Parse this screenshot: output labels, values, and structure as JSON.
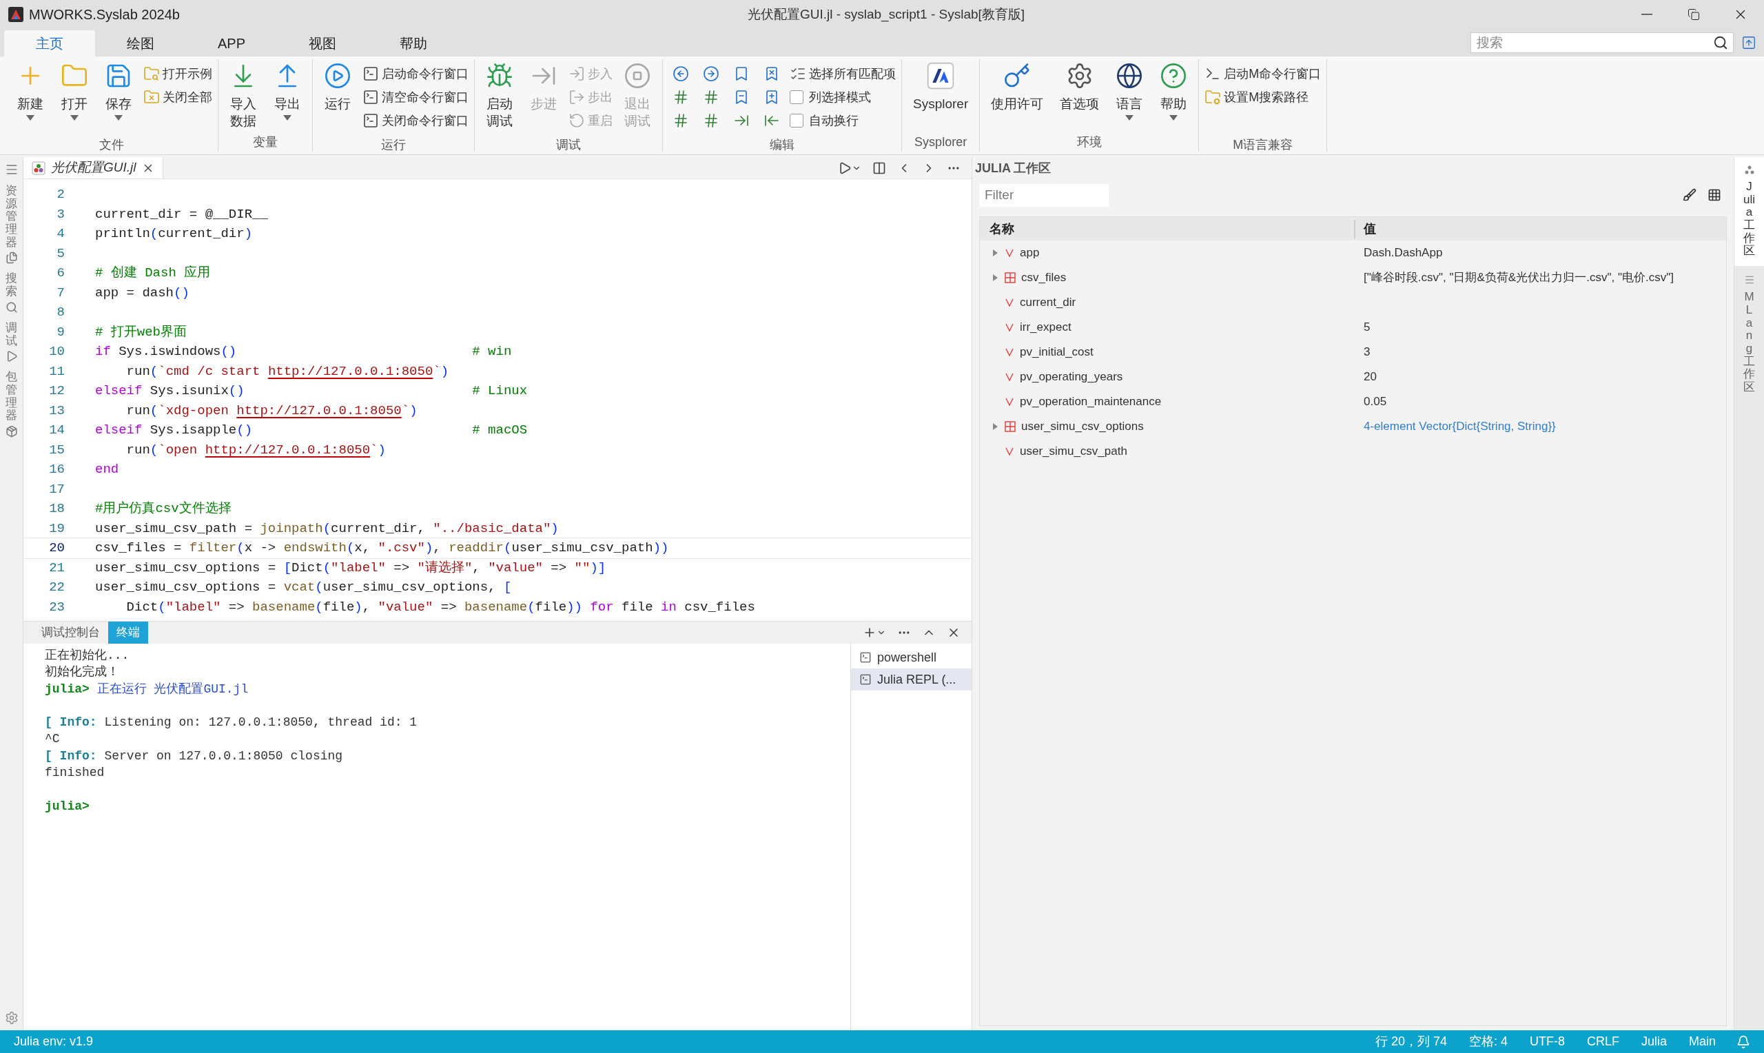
{
  "window": {
    "app_name": "MWORKS.Syslab 2024b",
    "title": "光伏配置GUI.jl - syslab_script1 - Syslab[教育版]"
  },
  "ribbon_tabs": [
    {
      "label": "主页",
      "selected": true
    },
    {
      "label": "绘图",
      "selected": false
    },
    {
      "label": "APP",
      "selected": false
    },
    {
      "label": "视图",
      "selected": false
    },
    {
      "label": "帮助",
      "selected": false
    }
  ],
  "search": {
    "placeholder": "搜索"
  },
  "ribbon_groups": [
    {
      "label": "文件",
      "items": [
        {
          "kind": "large",
          "lines": [
            "新建"
          ],
          "dropdown": true,
          "disabled": false
        },
        {
          "kind": "large",
          "lines": [
            "打开"
          ],
          "dropdown": true,
          "disabled": false
        },
        {
          "kind": "large",
          "lines": [
            "保存"
          ],
          "dropdown": true,
          "disabled": false
        },
        {
          "kind": "small",
          "label": "打开示例",
          "disabled": false
        },
        {
          "kind": "small",
          "label": "关闭全部",
          "disabled": false
        }
      ]
    },
    {
      "label": "变量",
      "items": [
        {
          "kind": "large",
          "lines": [
            "导入",
            "数据"
          ],
          "dropdown": false,
          "disabled": false
        },
        {
          "kind": "large",
          "lines": [
            "导出"
          ],
          "dropdown": true,
          "disabled": false
        }
      ]
    },
    {
      "label": "运行",
      "items": [
        {
          "kind": "large",
          "lines": [
            "运行"
          ],
          "dropdown": false,
          "disabled": false
        },
        {
          "kind": "small",
          "label": "启动命令行窗口",
          "disabled": false
        },
        {
          "kind": "small",
          "label": "清空命令行窗口",
          "disabled": false
        },
        {
          "kind": "small",
          "label": "关闭命令行窗口",
          "disabled": false
        }
      ]
    },
    {
      "label": "调试",
      "items": [
        {
          "kind": "large",
          "lines": [
            "启动",
            "调试"
          ],
          "dropdown": false,
          "disabled": false
        },
        {
          "kind": "large",
          "lines": [
            "步进"
          ],
          "dropdown": false,
          "disabled": true
        },
        {
          "kind": "small",
          "label": "步入",
          "disabled": true
        },
        {
          "kind": "small",
          "label": "步出",
          "disabled": true
        },
        {
          "kind": "small",
          "label": "重启",
          "disabled": true
        },
        {
          "kind": "large",
          "lines": [
            "退出",
            "调试"
          ],
          "dropdown": false,
          "disabled": true
        }
      ]
    },
    {
      "label": "编辑",
      "items": [
        {
          "kind": "icon",
          "disabled": false
        },
        {
          "kind": "icon",
          "disabled": false
        },
        {
          "kind": "icon",
          "disabled": false
        },
        {
          "kind": "icon",
          "disabled": false
        },
        {
          "kind": "icon",
          "disabled": false
        },
        {
          "kind": "icon",
          "disabled": false
        },
        {
          "kind": "icon",
          "disabled": false
        },
        {
          "kind": "icon",
          "disabled": false
        },
        {
          "kind": "icon",
          "disabled": false
        },
        {
          "kind": "icon",
          "disabled": false
        },
        {
          "kind": "icon",
          "disabled": false
        },
        {
          "kind": "icon",
          "disabled": false
        },
        {
          "kind": "small",
          "label": "选择所有匹配项",
          "disabled": false
        },
        {
          "kind": "check",
          "label": "列选择模式",
          "checked": false
        },
        {
          "kind": "check",
          "label": "自动换行",
          "checked": false
        }
      ]
    },
    {
      "label": "Sysplorer",
      "items": [
        {
          "kind": "large",
          "lines": [
            "Sysplorer"
          ],
          "dropdown": false,
          "disabled": false
        }
      ]
    },
    {
      "label": "环境",
      "items": [
        {
          "kind": "large",
          "lines": [
            "使用许可"
          ],
          "dropdown": false,
          "disabled": false
        },
        {
          "kind": "large",
          "lines": [
            "首选项"
          ],
          "dropdown": false,
          "disabled": false
        },
        {
          "kind": "large",
          "lines": [
            "语言"
          ],
          "dropdown": true,
          "disabled": false
        },
        {
          "kind": "large",
          "lines": [
            "帮助"
          ],
          "dropdown": true,
          "disabled": false
        }
      ]
    },
    {
      "label": "M语言兼容",
      "items": [
        {
          "kind": "small",
          "label": "启动M命令行窗口",
          "disabled": false
        },
        {
          "kind": "small",
          "label": "设置M搜索路径",
          "disabled": false
        }
      ]
    }
  ],
  "activity_bar": [
    {
      "label": "资源管理器"
    },
    {
      "label": "搜索"
    },
    {
      "label": "调试"
    },
    {
      "label": "包管理器"
    }
  ],
  "editor": {
    "tab": {
      "label": "光伏配置GUI.jl"
    },
    "lines": [
      {
        "number": "2",
        "current": false
      },
      {
        "number": "3",
        "current": false,
        "tokens": [
          {
            "kind": "plain",
            "text": "current_dir = @__DIR__"
          }
        ]
      },
      {
        "number": "4",
        "current": false,
        "tokens": [
          {
            "kind": "plain",
            "text": "println"
          },
          {
            "kind": "bracket",
            "text": "("
          },
          {
            "kind": "plain",
            "text": "current_dir"
          },
          {
            "kind": "bracket",
            "text": ")"
          }
        ]
      },
      {
        "number": "5",
        "current": false
      },
      {
        "number": "6",
        "current": false,
        "tokens": [
          {
            "kind": "comment",
            "text": "# 创建 Dash 应用"
          }
        ]
      },
      {
        "number": "7",
        "current": false,
        "tokens": [
          {
            "kind": "plain",
            "text": "app = dash"
          },
          {
            "kind": "bracket",
            "text": "()"
          }
        ]
      },
      {
        "number": "8",
        "current": false
      },
      {
        "number": "9",
        "current": false,
        "tokens": [
          {
            "kind": "comment",
            "text": "# 打开web界面"
          }
        ]
      },
      {
        "number": "10",
        "current": false,
        "tokens": [
          {
            "kind": "keyword",
            "text": "if"
          },
          {
            "kind": "plain",
            "text": " Sys.iswindows"
          },
          {
            "kind": "bracket",
            "text": "()"
          },
          {
            "kind": "aligned_comment",
            "text": "# win"
          }
        ]
      },
      {
        "number": "11",
        "current": false,
        "tokens": [
          {
            "kind": "plain",
            "text": "    run"
          },
          {
            "kind": "bracket",
            "text": "("
          },
          {
            "kind": "string",
            "text": "`cmd /c start "
          },
          {
            "kind": "url",
            "text": "http://127.0.0.1:8050"
          },
          {
            "kind": "string",
            "text": "`"
          },
          {
            "kind": "bracket",
            "text": ")"
          }
        ]
      },
      {
        "number": "12",
        "current": false,
        "tokens": [
          {
            "kind": "keyword",
            "text": "elseif"
          },
          {
            "kind": "plain",
            "text": " Sys.isunix"
          },
          {
            "kind": "bracket",
            "text": "()"
          },
          {
            "kind": "aligned_comment",
            "text": "# Linux"
          }
        ]
      },
      {
        "number": "13",
        "current": false,
        "tokens": [
          {
            "kind": "plain",
            "text": "    run"
          },
          {
            "kind": "bracket",
            "text": "("
          },
          {
            "kind": "string",
            "text": "`xdg-open "
          },
          {
            "kind": "url",
            "text": "http://127.0.0.1:8050"
          },
          {
            "kind": "string",
            "text": "`"
          },
          {
            "kind": "bracket",
            "text": ")"
          }
        ]
      },
      {
        "number": "14",
        "current": false,
        "tokens": [
          {
            "kind": "keyword",
            "text": "elseif"
          },
          {
            "kind": "plain",
            "text": " Sys.isapple"
          },
          {
            "kind": "bracket",
            "text": "()"
          },
          {
            "kind": "aligned_comment",
            "text": "# macOS"
          }
        ]
      },
      {
        "number": "15",
        "current": false,
        "tokens": [
          {
            "kind": "plain",
            "text": "    run"
          },
          {
            "kind": "bracket",
            "text": "("
          },
          {
            "kind": "string",
            "text": "`open "
          },
          {
            "kind": "url",
            "text": "http://127.0.0.1:8050"
          },
          {
            "kind": "string",
            "text": "`"
          },
          {
            "kind": "bracket",
            "text": ")"
          }
        ]
      },
      {
        "number": "16",
        "current": false,
        "tokens": [
          {
            "kind": "keyword",
            "text": "end"
          }
        ]
      },
      {
        "number": "17",
        "current": false
      },
      {
        "number": "18",
        "current": false,
        "tokens": [
          {
            "kind": "comment",
            "text": "#用户仿真csv文件选择"
          }
        ]
      },
      {
        "number": "19",
        "current": false,
        "tokens": [
          {
            "kind": "plain",
            "text": "user_simu_csv_path = "
          },
          {
            "kind": "function",
            "text": "joinpath"
          },
          {
            "kind": "bracket",
            "text": "("
          },
          {
            "kind": "plain",
            "text": "current_dir, "
          },
          {
            "kind": "string",
            "text": "\"../basic_data\""
          },
          {
            "kind": "bracket",
            "text": ")"
          }
        ]
      },
      {
        "number": "20",
        "current": true,
        "tokens": [
          {
            "kind": "plain",
            "text": "csv_files = "
          },
          {
            "kind": "function",
            "text": "filter"
          },
          {
            "kind": "bracket",
            "text": "("
          },
          {
            "kind": "plain",
            "text": "x -> "
          },
          {
            "kind": "function",
            "text": "endswith"
          },
          {
            "kind": "bracket",
            "text": "("
          },
          {
            "kind": "plain",
            "text": "x, "
          },
          {
            "kind": "string",
            "text": "\".csv\""
          },
          {
            "kind": "bracket",
            "text": ")"
          },
          {
            "kind": "plain",
            "text": ", "
          },
          {
            "kind": "function",
            "text": "readdir"
          },
          {
            "kind": "bracket",
            "text": "("
          },
          {
            "kind": "plain",
            "text": "user_simu_csv_path"
          },
          {
            "kind": "bracket",
            "text": "))"
          }
        ]
      },
      {
        "number": "21",
        "current": false,
        "tokens": [
          {
            "kind": "plain",
            "text": "user_simu_csv_options = "
          },
          {
            "kind": "bracket",
            "text": "["
          },
          {
            "kind": "plain",
            "text": "Dict"
          },
          {
            "kind": "bracket",
            "text": "("
          },
          {
            "kind": "string",
            "text": "\"label\""
          },
          {
            "kind": "plain",
            "text": " => "
          },
          {
            "kind": "string",
            "text": "\"请选择\""
          },
          {
            "kind": "plain",
            "text": ", "
          },
          {
            "kind": "string",
            "text": "\"value\""
          },
          {
            "kind": "plain",
            "text": " => "
          },
          {
            "kind": "string",
            "text": "\"\""
          },
          {
            "kind": "bracket",
            "text": ")]"
          }
        ]
      },
      {
        "number": "22",
        "current": false,
        "tokens": [
          {
            "kind": "plain",
            "text": "user_simu_csv_options = "
          },
          {
            "kind": "function",
            "text": "vcat"
          },
          {
            "kind": "bracket",
            "text": "("
          },
          {
            "kind": "plain",
            "text": "user_simu_csv_options, "
          },
          {
            "kind": "bracket",
            "text": "["
          }
        ]
      },
      {
        "number": "23",
        "current": false,
        "tokens": [
          {
            "kind": "plain",
            "text": "    Dict"
          },
          {
            "kind": "bracket",
            "text": "("
          },
          {
            "kind": "string",
            "text": "\"label\""
          },
          {
            "kind": "plain",
            "text": " => "
          },
          {
            "kind": "function",
            "text": "basename"
          },
          {
            "kind": "bracket",
            "text": "("
          },
          {
            "kind": "plain",
            "text": "file"
          },
          {
            "kind": "bracket",
            "text": ")"
          },
          {
            "kind": "plain",
            "text": ", "
          },
          {
            "kind": "string",
            "text": "\"value\""
          },
          {
            "kind": "plain",
            "text": " => "
          },
          {
            "kind": "function",
            "text": "basename"
          },
          {
            "kind": "bracket",
            "text": "("
          },
          {
            "kind": "plain",
            "text": "file"
          },
          {
            "kind": "bracket",
            "text": "))"
          },
          {
            "kind": "keyword",
            "text": " for"
          },
          {
            "kind": "plain",
            "text": " file "
          },
          {
            "kind": "keyword",
            "text": "in"
          },
          {
            "kind": "plain",
            "text": " csv_files"
          }
        ]
      }
    ]
  },
  "panel": {
    "tabs": [
      {
        "label": "调试控制台",
        "selected": false
      },
      {
        "label": "终端",
        "selected": true
      }
    ],
    "terminal_lines": [
      {
        "kind": "text",
        "segments": [
          {
            "kind": "output",
            "text": "正在初始化..."
          }
        ]
      },
      {
        "kind": "text",
        "segments": [
          {
            "kind": "output",
            "text": "初始化完成！"
          }
        ]
      },
      {
        "kind": "text",
        "segments": [
          {
            "kind": "prompt",
            "text": "julia>"
          },
          {
            "kind": "running",
            "text": "正在运行 光伏配置GUI.jl"
          }
        ]
      },
      {
        "kind": "blank"
      },
      {
        "kind": "text",
        "segments": [
          {
            "kind": "info",
            "text": "[ Info:"
          },
          {
            "kind": "output",
            "text": " Listening on: 127.0.0.1:8050, thread id: 1"
          }
        ]
      },
      {
        "kind": "text",
        "segments": [
          {
            "kind": "output",
            "text": "^C"
          }
        ]
      },
      {
        "kind": "text",
        "segments": [
          {
            "kind": "info",
            "text": "[ Info:"
          },
          {
            "kind": "output",
            "text": " Server on 127.0.0.1:8050 closing"
          }
        ]
      },
      {
        "kind": "text",
        "segments": [
          {
            "kind": "output",
            "text": "finished"
          }
        ]
      },
      {
        "kind": "blank"
      },
      {
        "kind": "text",
        "segments": [
          {
            "kind": "prompt",
            "text": "julia>"
          }
        ]
      }
    ],
    "terminals": [
      {
        "label": "powershell",
        "selected": false
      },
      {
        "label": "Julia REPL (...",
        "selected": true
      }
    ]
  },
  "workspace": {
    "title": "JULIA 工作区",
    "filter": {
      "placeholder": "Filter"
    },
    "columns": [
      "名称",
      "值"
    ],
    "rows": [
      {
        "kind": "variable",
        "name": "app",
        "value": "Dash.DashApp",
        "link": false,
        "expandable": true,
        "expanded": false
      },
      {
        "kind": "collection",
        "name": "csv_files",
        "value": "[\"峰谷时段.csv\", \"日期&负荷&光伏出力归一.csv\", \"电价.csv\"]",
        "link": false,
        "expandable": true,
        "expanded": false
      },
      {
        "kind": "variable",
        "name": "current_dir",
        "expandable": false
      },
      {
        "kind": "variable",
        "name": "irr_expect",
        "value": "5",
        "link": false,
        "expandable": false
      },
      {
        "kind": "variable",
        "name": "pv_initial_cost",
        "value": "3",
        "link": false,
        "expandable": false
      },
      {
        "kind": "variable",
        "name": "pv_operating_years",
        "value": "20",
        "link": false,
        "expandable": false
      },
      {
        "kind": "variable",
        "name": "pv_operation_maintenance",
        "value": "0.05",
        "link": false,
        "expandable": false
      },
      {
        "kind": "collection",
        "name": "user_simu_csv_options",
        "value": "4-element Vector{Dict{String, String}}",
        "link": true,
        "expandable": true,
        "expanded": false
      },
      {
        "kind": "variable",
        "name": "user_simu_csv_path",
        "expandable": false
      }
    ]
  },
  "side_tabs": [
    {
      "label": "Julia 工作区",
      "selected": true
    },
    {
      "label": "MLang 工作区",
      "selected": false
    }
  ],
  "status_bar": {
    "env": "Julia env: v1.9",
    "items": [
      "行 20，列 74",
      "空格: 4",
      "UTF-8",
      "CRLF",
      "Julia",
      "Main"
    ]
  }
}
